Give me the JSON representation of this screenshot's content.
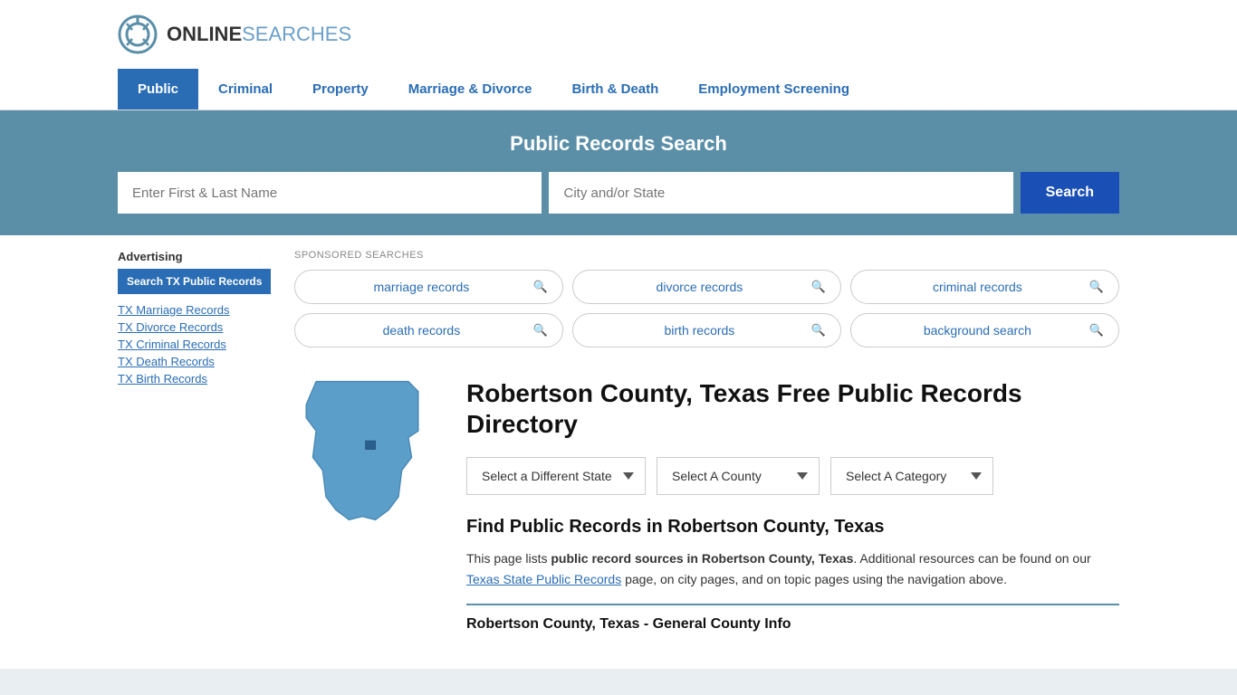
{
  "logo": {
    "online": "ONLINE",
    "searches": "SEARCHES"
  },
  "nav": {
    "items": [
      {
        "label": "Public",
        "active": true
      },
      {
        "label": "Criminal",
        "active": false
      },
      {
        "label": "Property",
        "active": false
      },
      {
        "label": "Marriage & Divorce",
        "active": false
      },
      {
        "label": "Birth & Death",
        "active": false
      },
      {
        "label": "Employment Screening",
        "active": false
      }
    ]
  },
  "banner": {
    "title": "Public Records Search",
    "name_placeholder": "Enter First & Last Name",
    "city_placeholder": "City and/or State",
    "search_button": "Search"
  },
  "sponsored": {
    "label": "SPONSORED SEARCHES",
    "items": [
      "marriage records",
      "divorce records",
      "criminal records",
      "death records",
      "birth records",
      "background search"
    ]
  },
  "county": {
    "title": "Robertson County, Texas Free Public Records Directory",
    "dropdowns": {
      "state": "Select a Different State",
      "county": "Select A County",
      "category": "Select A Category"
    }
  },
  "find": {
    "title": "Find Public Records in Robertson County, Texas",
    "description_start": "This page lists ",
    "description_bold": "public record sources in Robertson County, Texas",
    "description_middle": ". Additional resources can be found on our ",
    "link_text": "Texas State Public Records",
    "description_end": " page, on city pages, and on topic pages using the navigation above."
  },
  "general_info": {
    "title": "Robertson County, Texas - General County Info"
  },
  "sidebar": {
    "advertising_label": "Advertising",
    "ad_button": "Search TX Public Records",
    "links": [
      "TX Marriage Records",
      "TX Divorce Records",
      "TX Criminal Records",
      "TX Death Records",
      "TX Birth Records"
    ]
  }
}
